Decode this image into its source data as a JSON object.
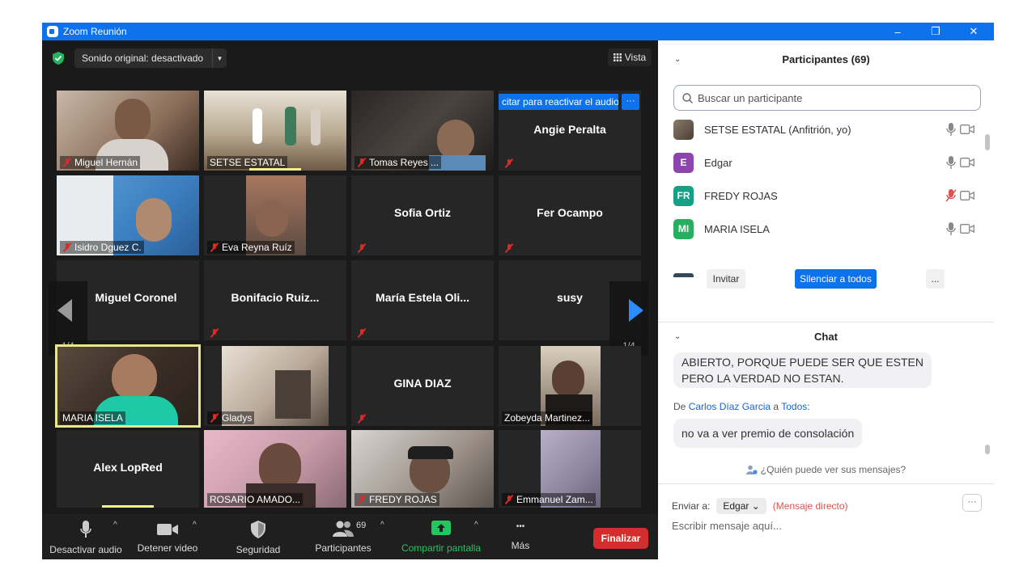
{
  "window": {
    "title": "Zoom Reunión",
    "minimize": "–",
    "maximize": "❐",
    "close": "✕"
  },
  "meeting_top": {
    "sound_button": "Sonido original: desactivado",
    "view_button": "Vista",
    "unmute_banner": "citar para reactivar el audio",
    "banner_more": "···"
  },
  "grid": {
    "page_left": "1/4",
    "page_right": "1/4",
    "tiles": [
      {
        "name": "Miguel Hernán",
        "video": true,
        "muted": true,
        "color": "#8a6e5a"
      },
      {
        "name": "SETSE ESTATAL",
        "video": true,
        "muted": false,
        "color": "#a89884"
      },
      {
        "name": "Tomas Reyes ...",
        "video": true,
        "muted": true,
        "color": "#3c3836"
      },
      {
        "name": "Angie Peralta",
        "video": false,
        "muted": true
      },
      {
        "name": "Isidro Dguez C.",
        "video": true,
        "muted": true,
        "color": "#3c7fc0"
      },
      {
        "name": "Eva Reyna Ruíz",
        "video": true,
        "muted": true,
        "color": "#5b4a42"
      },
      {
        "name": "Sofia Ortiz",
        "video": false,
        "muted": true
      },
      {
        "name": "Fer Ocampo",
        "video": false,
        "muted": true
      },
      {
        "name": "Miguel Coronel",
        "video": false,
        "muted": false
      },
      {
        "name": "Bonifacio  Ruiz...",
        "video": false,
        "muted": true
      },
      {
        "name": "María  Estela  Oli...",
        "video": false,
        "muted": true
      },
      {
        "name": "susy",
        "video": false,
        "muted": false
      },
      {
        "name": "MARIA ISELA",
        "video": true,
        "muted": false,
        "color": "#6b5a4c"
      },
      {
        "name": "Gladys",
        "video": true,
        "muted": true,
        "color": "#8a7d70"
      },
      {
        "name": "GINA DIAZ",
        "video": false,
        "muted": true
      },
      {
        "name": "Zobeyda Martinez...",
        "video": true,
        "muted": false,
        "color": "#7a6a5c"
      },
      {
        "name": "Alex LopRed",
        "video": false,
        "muted": false
      },
      {
        "name": "ROSARIO AMADO...",
        "video": true,
        "muted": false,
        "color": "#c79aa8"
      },
      {
        "name": "FREDY ROJAS",
        "video": true,
        "muted": true,
        "color": "#9a9088"
      },
      {
        "name": "Emmanuel Zam...",
        "video": true,
        "muted": true,
        "color": "#8e86a0"
      }
    ]
  },
  "controls": {
    "mute": "Desactivar audio",
    "video": "Detener video",
    "security": "Seguridad",
    "participants": "Participantes",
    "participants_count": "69",
    "share": "Compartir pantalla",
    "more": "Más",
    "end": "Finalizar",
    "caret": "^",
    "more_dots": "•••"
  },
  "participants_panel": {
    "title": "Participantes (69)",
    "search_placeholder": "Buscar un participante",
    "people": [
      {
        "name": "SETSE ESTATAL (Anfitrión, yo)",
        "initials": "",
        "color": "#6a5a4a",
        "muted": false
      },
      {
        "name": "Edgar",
        "initials": "E",
        "color": "#8e44ad",
        "muted": false
      },
      {
        "name": "FREDY ROJAS",
        "initials": "FR",
        "color": "#16a085",
        "muted": true
      },
      {
        "name": "MARIA ISELA",
        "initials": "MI",
        "color": "#27ae60",
        "muted": false
      }
    ],
    "invite": "Invitar",
    "mute_all": "Silenciar a todos",
    "more": "..."
  },
  "chat": {
    "title": "Chat",
    "msg1_line1": "ABIERTO, PORQUE PUEDE SER QUE ESTEN",
    "msg1_line2": "PERO LA VERDAD NO ESTAN.",
    "from_prefix": "De",
    "from_name": "Carlos Díaz Garcia",
    "from_mid": "a",
    "from_target": "Todos:",
    "msg2": "no va a ver premio de consolación",
    "who_can_see": "¿Quién puede ver sus mensajes?",
    "send_to_label": "Enviar a:",
    "send_to_value": "Edgar",
    "direct": "(Mensaje directo)",
    "more": "···",
    "compose_placeholder": "Escribir mensaje aquí..."
  }
}
